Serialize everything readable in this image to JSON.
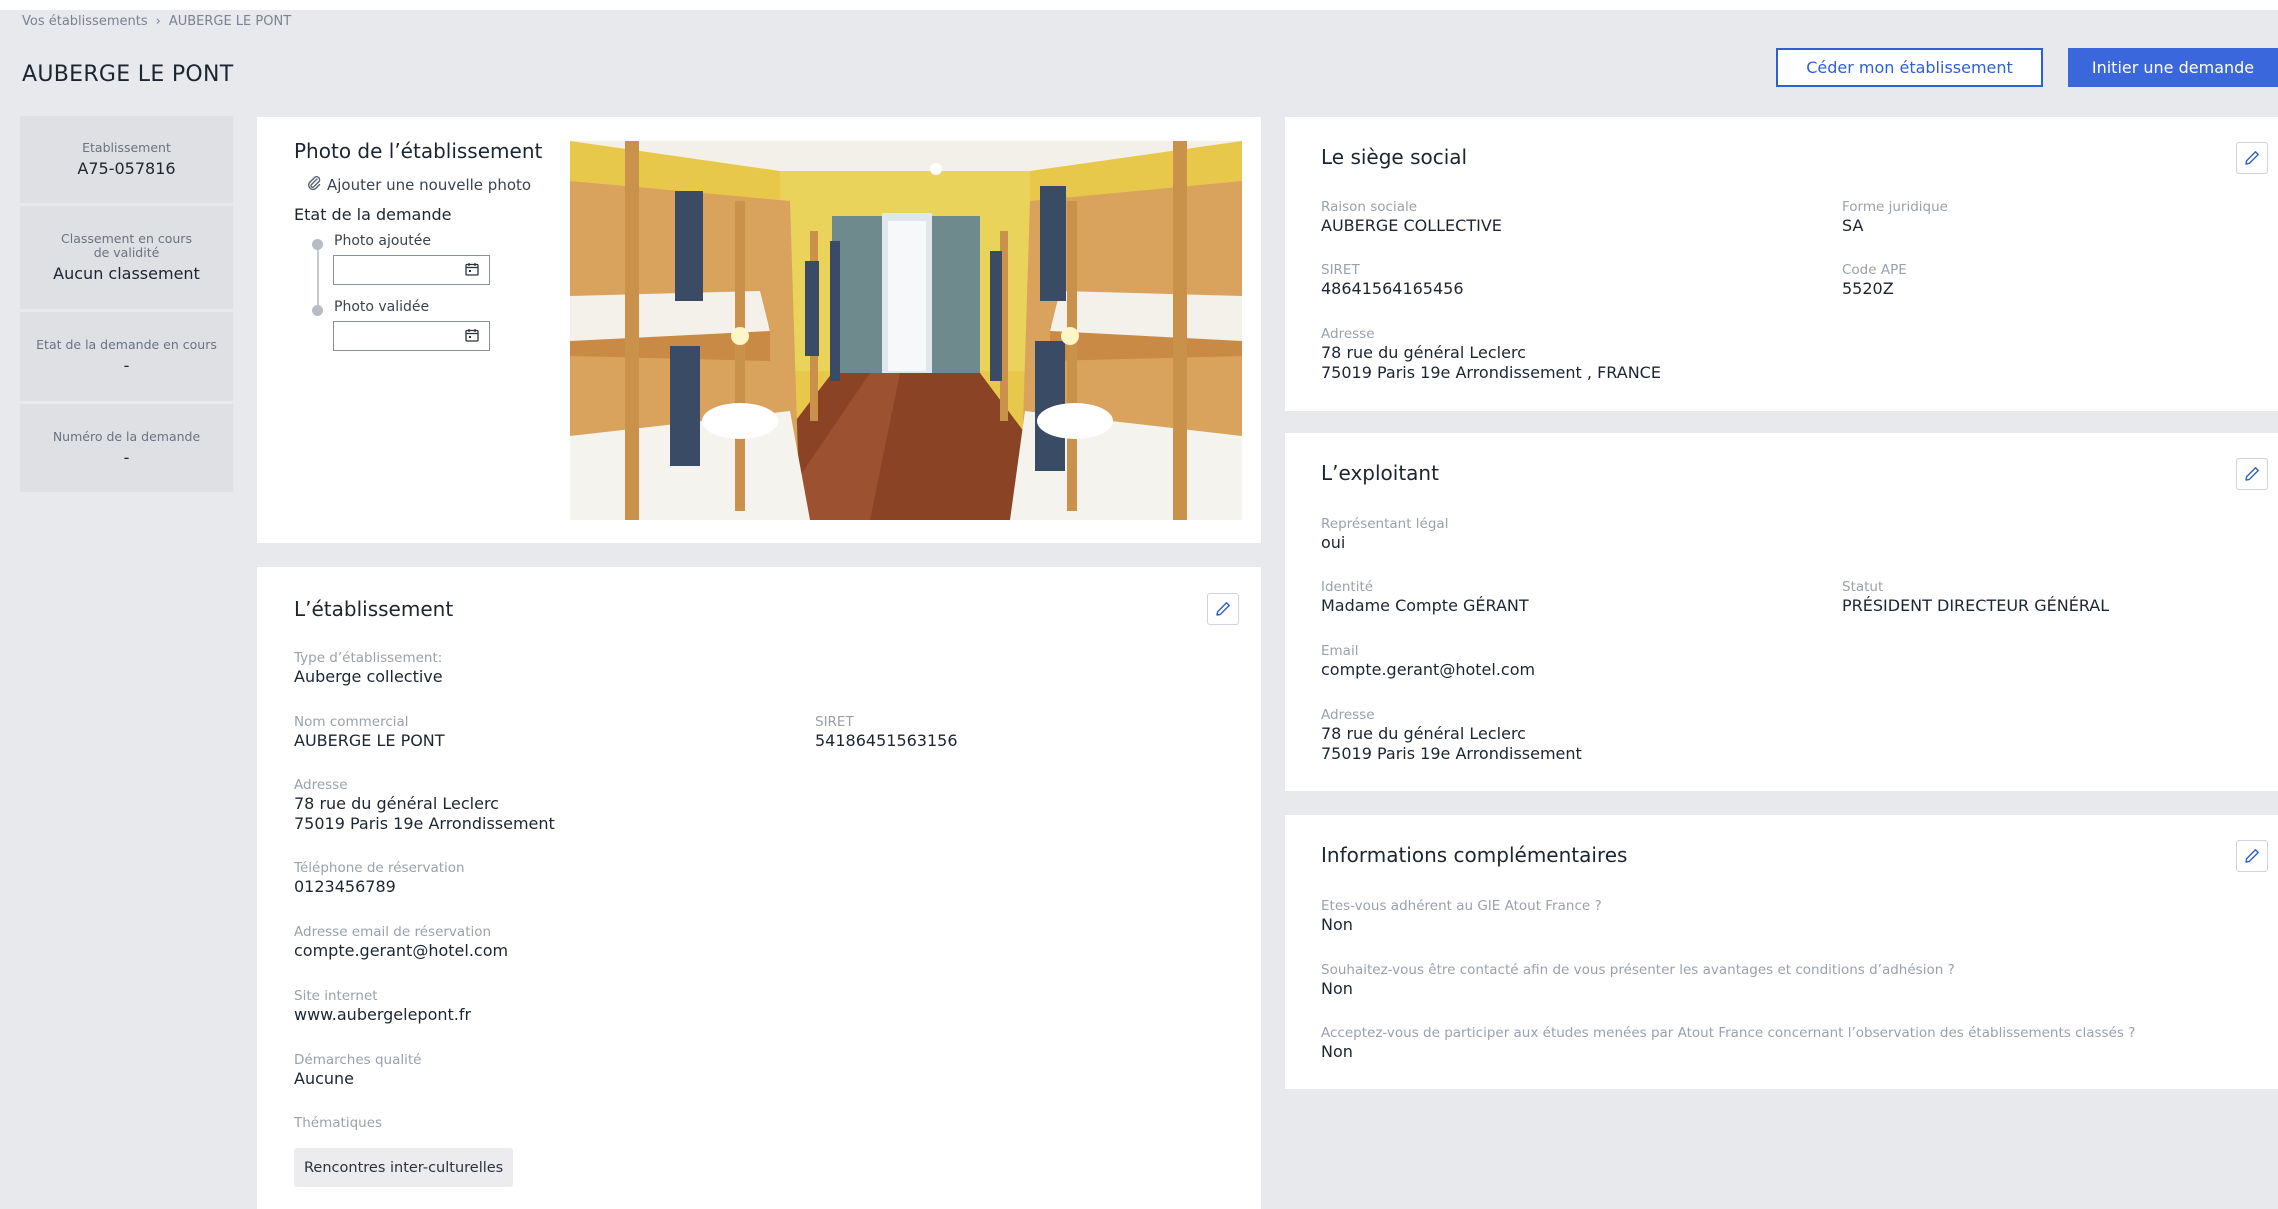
{
  "breadcrumb": {
    "root": "Vos établissements",
    "separator": "›",
    "current": "AUBERGE LE PONT"
  },
  "page_title": "AUBERGE LE PONT",
  "actions": {
    "cede": "Céder mon établissement",
    "initiate": "Initier une demande"
  },
  "sidebar": {
    "tiles": [
      {
        "label": "Etablissement",
        "value": "A75-057816"
      },
      {
        "label": "Classement en cours de validité",
        "value": "Aucun classement"
      },
      {
        "label": "Etat de la demande en cours",
        "value": "-"
      },
      {
        "label": "Numéro de la demande",
        "value": "-"
      }
    ]
  },
  "photo": {
    "title": "Photo de l’établissement",
    "add_link": "Ajouter une nouvelle photo",
    "state_title": "Etat de la demande",
    "steps": [
      {
        "label": "Photo ajoutée"
      },
      {
        "label": "Photo validée"
      }
    ]
  },
  "etablissement": {
    "title": "L’établissement",
    "type_label": "Type d’établissement:",
    "type_value": "Auberge collective",
    "nom_label": "Nom commercial",
    "nom_value": "AUBERGE LE PONT",
    "siret_label": "SIRET",
    "siret_value": "54186451563156",
    "adresse_label": "Adresse",
    "adresse_line1": "78 rue du général Leclerc",
    "adresse_line2": "75019 Paris 19e Arrondissement",
    "tel_label": "Téléphone de réservation",
    "tel_value": "0123456789",
    "email_label": "Adresse email de réservation",
    "email_value": "compte.gerant@hotel.com",
    "site_label": "Site internet",
    "site_value": "www.aubergelepont.fr",
    "demarches_label": "Démarches qualité",
    "demarches_value": "Aucune",
    "thematiques_label": "Thématiques",
    "thematiques_tag": "Rencontres inter-culturelles"
  },
  "siege": {
    "title": "Le siège social",
    "raison_label": "Raison sociale",
    "raison_value": "AUBERGE COLLECTIVE",
    "forme_label": "Forme juridique",
    "forme_value": "SA",
    "siret_label": "SIRET",
    "siret_value": "48641564165456",
    "ape_label": "Code APE",
    "ape_value": "5520Z",
    "adresse_label": "Adresse",
    "adresse_line1": "78 rue du général Leclerc",
    "adresse_line2": "75019 Paris 19e Arrondissement , FRANCE"
  },
  "exploitant": {
    "title": "L’exploitant",
    "rep_label": "Représentant légal",
    "rep_value": "oui",
    "identite_label": "Identité",
    "identite_value": "Madame Compte GÉRANT",
    "statut_label": "Statut",
    "statut_value": "PRÉSIDENT DIRECTEUR GÉNÉRAL",
    "email_label": "Email",
    "email_value": "compte.gerant@hotel.com",
    "adresse_label": "Adresse",
    "adresse_line1": "78 rue du général Leclerc",
    "adresse_line2": "75019 Paris 19e Arrondissement"
  },
  "infos": {
    "title": "Informations complémentaires",
    "q1": "Etes-vous adhérent au GIE Atout France ?",
    "a1": "Non",
    "q2": "Souhaitez-vous être contacté afin de vous présenter les avantages et conditions d’adhésion ?",
    "a2": "Non",
    "q3": "Acceptez-vous de participer aux études menées par Atout France concernant l’observation des établissements classés ?",
    "a3": "Non"
  },
  "colors": {
    "primary": "#3a67db",
    "background": "#e8e9ec",
    "card": "#ffffff",
    "tile": "#dfe0e3",
    "label": "#9aa1ab"
  }
}
